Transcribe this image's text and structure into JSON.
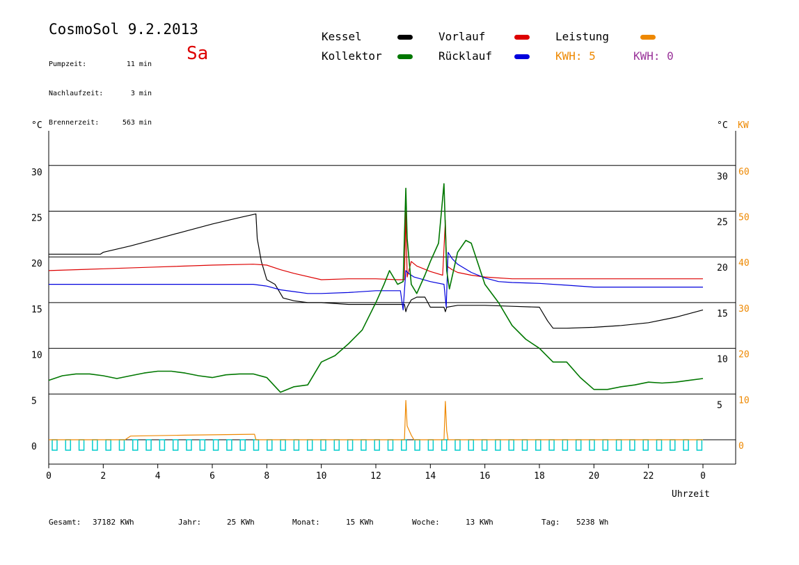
{
  "header": {
    "title": "CosmoSol 9.2.2013",
    "day": "Sa",
    "stats": [
      {
        "label": "Pumpzeit:",
        "value": "11 min"
      },
      {
        "label": "Nachlaufzeit:",
        "value": "3 min"
      },
      {
        "label": "Brennerzeit:",
        "value": "563 min"
      }
    ]
  },
  "legend": {
    "items": [
      {
        "label": "Kessel",
        "color": "#000000"
      },
      {
        "label": "Vorlauf",
        "color": "#dd0000"
      },
      {
        "label": "Leistung",
        "color": "#ee8800"
      },
      {
        "label": "Kollektor",
        "color": "#007700"
      },
      {
        "label": "Rücklauf",
        "color": "#0000dd"
      }
    ],
    "kwh1": "KWH: 5",
    "kwh2": "KWH: 0",
    "kwh1_color": "#ee8800",
    "kwh2_color": "#993399"
  },
  "footer": {
    "gesamt_label": "Gesamt:",
    "gesamt_value": "37182 KWh",
    "jahr_label": "Jahr:",
    "jahr_value": "25 KWh",
    "monat_label": "Monat:",
    "monat_value": "15 KWh",
    "woche_label": "Woche:",
    "woche_value": "13 KWh",
    "tag_label": "Tag:",
    "tag_value": "5238 Wh"
  },
  "chart_data": {
    "type": "line",
    "xlabel": "Uhrzeit",
    "ylabel_left": "°C",
    "ylabel_right": "°C",
    "ylabel_right2": "KW",
    "xlim": [
      0,
      24
    ],
    "ylim": [
      0,
      35
    ],
    "x_ticks": [
      0,
      2,
      4,
      6,
      8,
      10,
      12,
      14,
      16,
      18,
      20,
      22,
      24
    ],
    "x_tick_labels": [
      "0",
      "2",
      "4",
      "6",
      "8",
      "10",
      "12",
      "14",
      "16",
      "18",
      "20",
      "22",
      "0"
    ],
    "y_ticks_left": [
      0,
      5,
      10,
      15,
      20,
      25,
      30
    ],
    "y_ticks_right": [
      5,
      10,
      15,
      20,
      25,
      30
    ],
    "y_ticks_kw": [
      0,
      10,
      20,
      30,
      40,
      50,
      60
    ],
    "grid": true,
    "series": [
      {
        "name": "Kessel",
        "color": "#000000",
        "x": [
          0,
          1.9,
          2,
          3,
          4,
          5,
          6,
          7,
          7.6,
          7.65,
          7.8,
          8,
          8.3,
          8.6,
          9,
          9.5,
          10,
          11,
          12,
          12.9,
          13.05,
          13.1,
          13.15,
          13.3,
          13.5,
          13.8,
          14,
          14.3,
          14.5,
          14.55,
          14.6,
          14.8,
          15,
          16,
          17,
          18,
          18.3,
          18.5,
          19,
          20,
          21,
          22,
          23,
          24
        ],
        "y": [
          20.3,
          20.3,
          20.5,
          21.2,
          22,
          22.8,
          23.6,
          24.3,
          24.7,
          22,
          19.5,
          17.5,
          17,
          15.5,
          15.2,
          15,
          15,
          14.8,
          14.8,
          14.8,
          14.8,
          14,
          14.5,
          15.3,
          15.6,
          15.6,
          14.5,
          14.5,
          14.5,
          14,
          14.5,
          14.6,
          14.7,
          14.7,
          14.6,
          14.5,
          13,
          12.2,
          12.2,
          12.3,
          12.5,
          12.8,
          13.4,
          14.2
        ]
      },
      {
        "name": "Vorlauf",
        "color": "#dd0000",
        "x": [
          0,
          2,
          4,
          6,
          7.5,
          8,
          8.5,
          9,
          10,
          11,
          12,
          12.8,
          13.05,
          13.1,
          13.15,
          13.3,
          13.5,
          14,
          14.45,
          14.55,
          14.6,
          14.8,
          15,
          15.5,
          16,
          17,
          18,
          19,
          20,
          21,
          22,
          23,
          24
        ],
        "y": [
          18.5,
          18.7,
          18.9,
          19.1,
          19.2,
          19.1,
          18.6,
          18.2,
          17.5,
          17.6,
          17.6,
          17.5,
          17.5,
          25,
          17.8,
          19.5,
          19,
          18.4,
          18,
          24,
          19,
          18.6,
          18.3,
          18,
          17.8,
          17.6,
          17.6,
          17.6,
          17.6,
          17.6,
          17.6,
          17.6,
          17.6
        ]
      },
      {
        "name": "Rücklauf",
        "color": "#0000dd",
        "x": [
          0,
          2,
          4,
          6,
          7.5,
          8,
          8.5,
          9,
          9.5,
          10,
          11,
          12,
          12.9,
          13.0,
          13.1,
          13.2,
          13.4,
          14,
          14.5,
          14.58,
          14.65,
          14.8,
          15,
          15.5,
          16,
          16.5,
          17,
          18,
          19,
          20,
          21,
          22,
          23,
          24
        ],
        "y": [
          17,
          17,
          17,
          17,
          17,
          16.8,
          16.4,
          16.2,
          16,
          16,
          16.1,
          16.3,
          16.3,
          14.2,
          18.5,
          18.2,
          17.8,
          17.3,
          17,
          14.5,
          20.5,
          19.8,
          19.2,
          18.3,
          17.7,
          17.3,
          17.2,
          17.1,
          16.9,
          16.7,
          16.7,
          16.7,
          16.7,
          16.7
        ]
      },
      {
        "name": "Kollektor",
        "color": "#007700",
        "x": [
          0,
          0.5,
          1,
          1.5,
          2,
          2.5,
          3,
          3.5,
          4,
          4.5,
          5,
          5.5,
          6,
          6.5,
          7,
          7.5,
          8,
          8.5,
          9,
          9.5,
          10,
          10.5,
          11,
          11.5,
          12,
          12.3,
          12.5,
          12.8,
          13,
          13.1,
          13.15,
          13.3,
          13.5,
          13.8,
          14,
          14.3,
          14.5,
          14.6,
          14.7,
          15,
          15.3,
          15.5,
          16,
          16.5,
          17,
          17.5,
          18,
          18.5,
          19,
          19.5,
          20,
          20.5,
          21,
          21.5,
          22,
          22.5,
          23,
          23.5,
          24
        ],
        "y": [
          6.5,
          7,
          7.2,
          7.2,
          7,
          6.7,
          7,
          7.3,
          7.5,
          7.5,
          7.3,
          7,
          6.8,
          7.1,
          7.2,
          7.2,
          6.8,
          5.2,
          5.8,
          6,
          8.5,
          9.2,
          10.5,
          12,
          15,
          17,
          18.5,
          17,
          17.3,
          27.5,
          22,
          17,
          16,
          18,
          19.5,
          21.5,
          28,
          18.5,
          16.5,
          20.5,
          21.8,
          21.5,
          17,
          15,
          12.5,
          11,
          10,
          8.5,
          8.5,
          6.8,
          5.5,
          5.5,
          5.8,
          6,
          6.3,
          6.2,
          6.3,
          6.5,
          6.7
        ]
      },
      {
        "name": "Leistung",
        "color": "#ee8800",
        "x": [
          0,
          2.8,
          3,
          5,
          7.5,
          7.55,
          7.6,
          13.0,
          13.05,
          13.1,
          13.15,
          13.3,
          13.4,
          14.5,
          14.55,
          14.6,
          14.65,
          24
        ],
        "y": [
          0,
          0,
          0.4,
          0.5,
          0.6,
          0.6,
          0,
          0,
          0,
          4.3,
          1.5,
          0.5,
          0,
          0,
          4.2,
          1,
          0,
          0
        ]
      }
    ]
  }
}
